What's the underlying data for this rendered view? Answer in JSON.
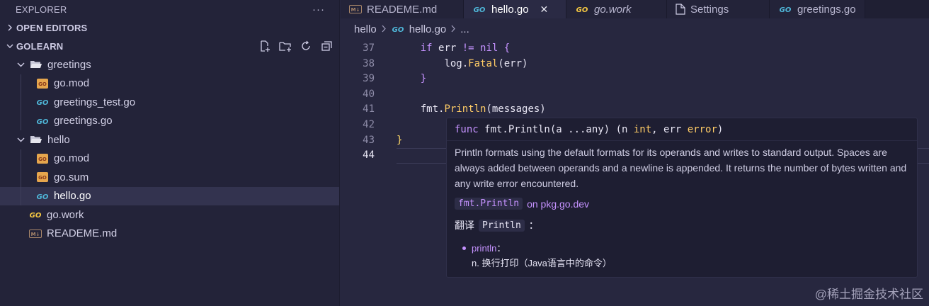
{
  "sidebar": {
    "title": "EXPLORER",
    "more": "···",
    "open_editors": "OPEN EDITORS",
    "workspace": "GOLEARN",
    "tree": [
      {
        "label": "greetings"
      },
      {
        "label": "go.mod"
      },
      {
        "label": "greetings_test.go"
      },
      {
        "label": "greetings.go"
      },
      {
        "label": "hello"
      },
      {
        "label": "go.mod"
      },
      {
        "label": "go.sum"
      },
      {
        "label": "hello.go"
      },
      {
        "label": "go.work"
      },
      {
        "label": "READEME.md"
      }
    ]
  },
  "tabs": [
    {
      "label": "READEME.md"
    },
    {
      "label": "hello.go"
    },
    {
      "label": "go.work"
    },
    {
      "label": "Settings"
    },
    {
      "label": "greetings.go"
    }
  ],
  "tab_close": "✕",
  "breadcrumb": {
    "folder": "hello",
    "file": "hello.go",
    "more": "..."
  },
  "code": {
    "line_numbers": [
      "37",
      "38",
      "39",
      "40",
      "41",
      "42",
      "43",
      "44"
    ],
    "l37": {
      "kw": "if",
      "var": "err",
      "op": "!=",
      "nil": "nil",
      "brace": "{"
    },
    "l38": {
      "pkg": "log.",
      "fn": "Fatal",
      "arg": "(err)"
    },
    "l39": {
      "brace": "}"
    },
    "l41": {
      "pkg": "fmt.",
      "fn": "Println",
      "arg": "(messages)"
    },
    "l43": {
      "brace": "}"
    }
  },
  "hover": {
    "sig_kw": "func",
    "sig_rest": " fmt.Println(a ...any) (n ",
    "sig_int": "int",
    "sig_mid": ", err ",
    "sig_err": "error",
    "sig_end": ")",
    "doc": "Println formats using the default formats for its operands and writes to standard output. Spaces are always added between operands and a newline is appended. It returns the number of bytes written and any write error encountered.",
    "link_code": "fmt.Println",
    "link_text": "on pkg.go.dev",
    "translate_label": "翻译",
    "translate_word": "Println",
    "translate_colon": "：",
    "entry_word": "println",
    "entry_colon": "：",
    "entry_def": "n. 换行打印（Java语言中的命令）"
  },
  "watermark": "@稀土掘金技术社区",
  "colors": {
    "accent": "#c592ff",
    "go_icon": "#4fb6d8",
    "gold": "#ffcc66"
  }
}
